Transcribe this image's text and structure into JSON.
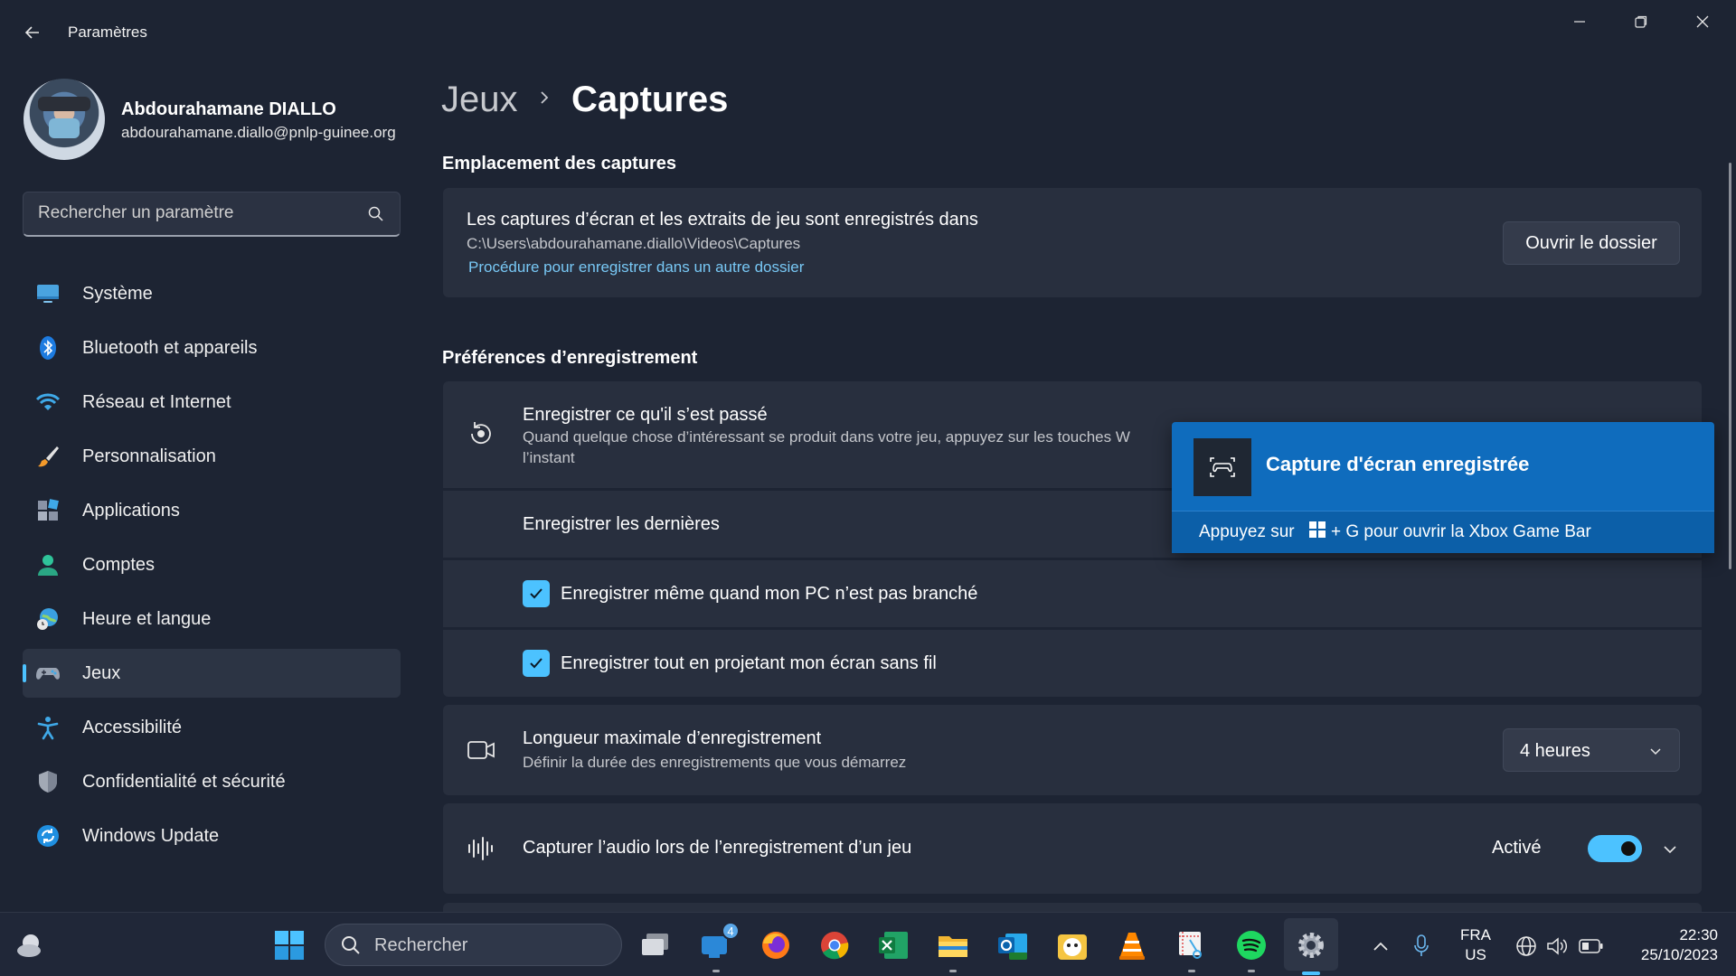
{
  "window": {
    "app_title": "Paramètres"
  },
  "user": {
    "name": "Abdourahamane DIALLO",
    "email": "abdourahamane.diallo@pnlp-guinee.org"
  },
  "sidebar": {
    "search_placeholder": "Rechercher un paramètre",
    "items": [
      {
        "label": "Système",
        "icon": "monitor-icon"
      },
      {
        "label": "Bluetooth et appareils",
        "icon": "bluetooth-icon"
      },
      {
        "label": "Réseau et Internet",
        "icon": "wifi-icon"
      },
      {
        "label": "Personnalisation",
        "icon": "paintbrush-icon"
      },
      {
        "label": "Applications",
        "icon": "apps-icon"
      },
      {
        "label": "Comptes",
        "icon": "person-icon"
      },
      {
        "label": "Heure et langue",
        "icon": "globe-clock-icon"
      },
      {
        "label": "Jeux",
        "icon": "gamepad-icon",
        "active": true
      },
      {
        "label": "Accessibilité",
        "icon": "accessibility-icon"
      },
      {
        "label": "Confidentialité et sécurité",
        "icon": "shield-icon"
      },
      {
        "label": "Windows Update",
        "icon": "refresh-icon"
      }
    ]
  },
  "breadcrumb": {
    "parent": "Jeux",
    "current": "Captures"
  },
  "location_section": {
    "title": "Emplacement des captures",
    "line1": "Les captures d’écran et les extraits de jeu sont enregistrés dans",
    "path": "C:\\Users\\abdourahamane.diallo\\Videos\\Captures",
    "link": "Procédure pour enregistrer dans un autre dossier",
    "open_button": "Ouvrir le dossier"
  },
  "prefs_section": {
    "title": "Préférences d’enregistrement",
    "record_past": {
      "title": "Enregistrer ce qu'il s’est passé",
      "desc_line1": "Quand quelque chose d’intéressant se produit dans votre jeu, appuyez sur les touches W",
      "desc_line2": "l’instant"
    },
    "record_last": {
      "title": "Enregistrer les dernières"
    },
    "checkbox_unplugged": {
      "label": "Enregistrer même quand mon PC n’est pas branché",
      "checked": true
    },
    "checkbox_wireless": {
      "label": "Enregistrer tout en projetant mon écran sans fil",
      "checked": true
    },
    "max_length": {
      "title": "Longueur maximale d’enregistrement",
      "desc": "Définir la durée des enregistrements que vous démarrez",
      "selected": "4 heures"
    },
    "audio": {
      "title": "Capturer l’audio lors de l’enregistrement d’un jeu",
      "state_label": "Activé",
      "on": true
    }
  },
  "toast": {
    "title": "Capture d'écran enregistrée",
    "footer_pre": "Appuyez sur",
    "footer_post": "+ G pour ouvrir la Xbox Game Bar"
  },
  "taskbar": {
    "search_placeholder": "Rechercher",
    "teams_badge": "4",
    "lang_line1": "FRA",
    "lang_line2": "US",
    "time": "22:30",
    "date": "25/10/2023",
    "accent": "#4cc2ff"
  }
}
